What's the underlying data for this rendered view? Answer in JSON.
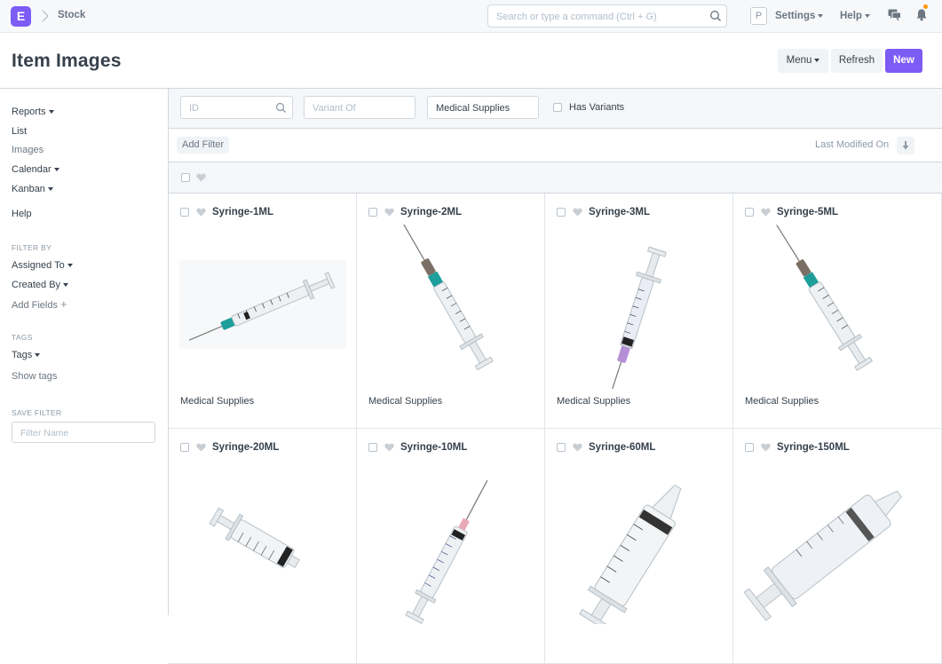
{
  "app": {
    "logo": "E",
    "breadcrumb": "Stock"
  },
  "navbar": {
    "search_placeholder": "Search or type a command (Ctrl + G)",
    "avatar_letter": "P",
    "settings_label": "Settings",
    "help_label": "Help"
  },
  "page": {
    "title": "Item Images",
    "menu_label": "Menu",
    "refresh_label": "Refresh",
    "new_label": "New"
  },
  "sidebar": {
    "reports": "Reports",
    "list": "List",
    "images": "Images",
    "calendar": "Calendar",
    "kanban": "Kanban",
    "help": "Help",
    "filter_by_label": "FILTER BY",
    "assigned_to": "Assigned To",
    "created_by": "Created By",
    "add_fields": "Add Fields",
    "tags_label": "TAGS",
    "tags": "Tags",
    "show_tags": "Show tags",
    "save_filter_label": "SAVE FILTER",
    "filter_name_placeholder": "Filter Name"
  },
  "filters": {
    "id_placeholder": "ID",
    "variant_of_placeholder": "Variant Of",
    "item_group_value": "Medical Supplies",
    "has_variants_label": "Has Variants",
    "add_filter_label": "Add Filter",
    "sort_label": "Last Modified On"
  },
  "items": [
    {
      "name": "Syringe-1ML",
      "group": "Medical Supplies"
    },
    {
      "name": "Syringe-2ML",
      "group": "Medical Supplies"
    },
    {
      "name": "Syringe-3ML",
      "group": "Medical Supplies"
    },
    {
      "name": "Syringe-5ML",
      "group": "Medical Supplies"
    },
    {
      "name": "Syringe-20ML",
      "group": ""
    },
    {
      "name": "Syringe-10ML",
      "group": ""
    },
    {
      "name": "Syringe-60ML",
      "group": ""
    },
    {
      "name": "Syringe-150ML",
      "group": ""
    }
  ],
  "colors": {
    "accent": "#7d5bf5",
    "notification": "#ff9800",
    "syringe_hub_teal": "#1e9e9a"
  }
}
